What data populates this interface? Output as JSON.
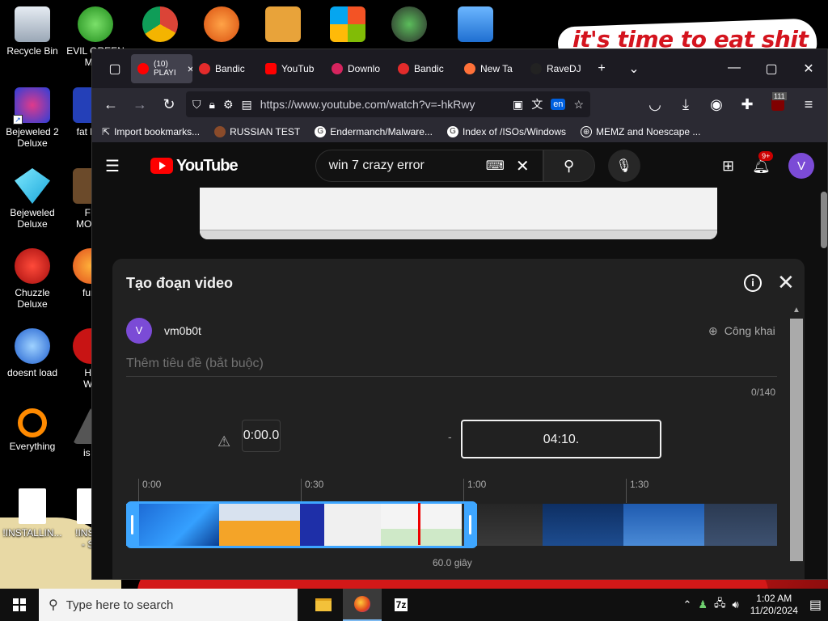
{
  "desktop": {
    "wallpaper_text": "it's time to eat shit",
    "icons": [
      {
        "label": "Recycle Bin",
        "icon": "recycle-bin-icon"
      },
      {
        "label": "Bejeweled 2\nDeluxe",
        "icon": "bejeweled2-icon"
      },
      {
        "label": "Bejeweled\nDeluxe",
        "icon": "bejeweled-icon"
      },
      {
        "label": "Chuzzle\nDeluxe",
        "icon": "chuzzle-icon"
      },
      {
        "label": "doesnt load",
        "icon": "thunderbird-icon"
      },
      {
        "label": "Everything",
        "icon": "everything-icon"
      },
      {
        "label": "!INSTALLIN...",
        "icon": "text-file-icon"
      },
      {
        "label": "EVIL GREEN\nMEN",
        "icon": "green-men-icon"
      },
      {
        "label": "fat like",
        "icon": "fat-like-icon"
      },
      {
        "label": "FF\nMONK",
        "icon": "ff-monk-icon"
      },
      {
        "label": "fury",
        "icon": "firefox-fury-icon"
      },
      {
        "label": "He\nWe",
        "icon": "he-we-icon"
      },
      {
        "label": "is v",
        "icon": "is-v-icon"
      },
      {
        "label": "!INSTA\n- Sh",
        "icon": "text-file-icon-2"
      }
    ]
  },
  "browser": {
    "tabs": [
      {
        "label": "(10)\nPLAYI",
        "favicon_color": "#ff0000",
        "active": true
      },
      {
        "label": "Bandic",
        "favicon_color": "#e32b2b"
      },
      {
        "label": "YouTub",
        "favicon_color": "#ff0000"
      },
      {
        "label": "Downlo",
        "favicon_color": "#d6245e"
      },
      {
        "label": "Bandic",
        "favicon_color": "#e32b2b"
      },
      {
        "label": "New Ta",
        "favicon_color": "#ff7139"
      },
      {
        "label": "RaveDJ",
        "favicon_color": "#222222"
      }
    ],
    "url": "https://www.youtube.com/watch?v=-hkRwy",
    "translate_badge": "en",
    "ext_badge": "111",
    "bookmarks": [
      {
        "label": "Import bookmarks..."
      },
      {
        "label": "RUSSIAN TEST"
      },
      {
        "label": "Endermanch/Malware..."
      },
      {
        "label": "Index of /ISOs/Windows"
      },
      {
        "label": "MEMZ and Noescape ..."
      }
    ]
  },
  "youtube": {
    "logo_text": "YouTube",
    "search_value": "win 7 crazy error",
    "notification_count": "9+",
    "avatar_letter": "V",
    "clip": {
      "title": "Tạo đoạn video",
      "channel_initial": "V",
      "channel_name": "vm0b0t",
      "visibility": "Công khai",
      "title_placeholder": "Thêm tiêu đề (bắt buộc)",
      "char_count": "0/140",
      "start_time": "0:00.0",
      "end_time": "04:10.",
      "separator": "-",
      "ruler": [
        "0:00",
        "0:30",
        "1:00",
        "1:30"
      ],
      "duration_label": "60.0 giây",
      "selection_fraction": 0.5,
      "playhead_seconds": 54
    }
  },
  "taskbar": {
    "search_placeholder": "Type here to search",
    "time": "1:02 AM",
    "date": "11/20/2024"
  }
}
